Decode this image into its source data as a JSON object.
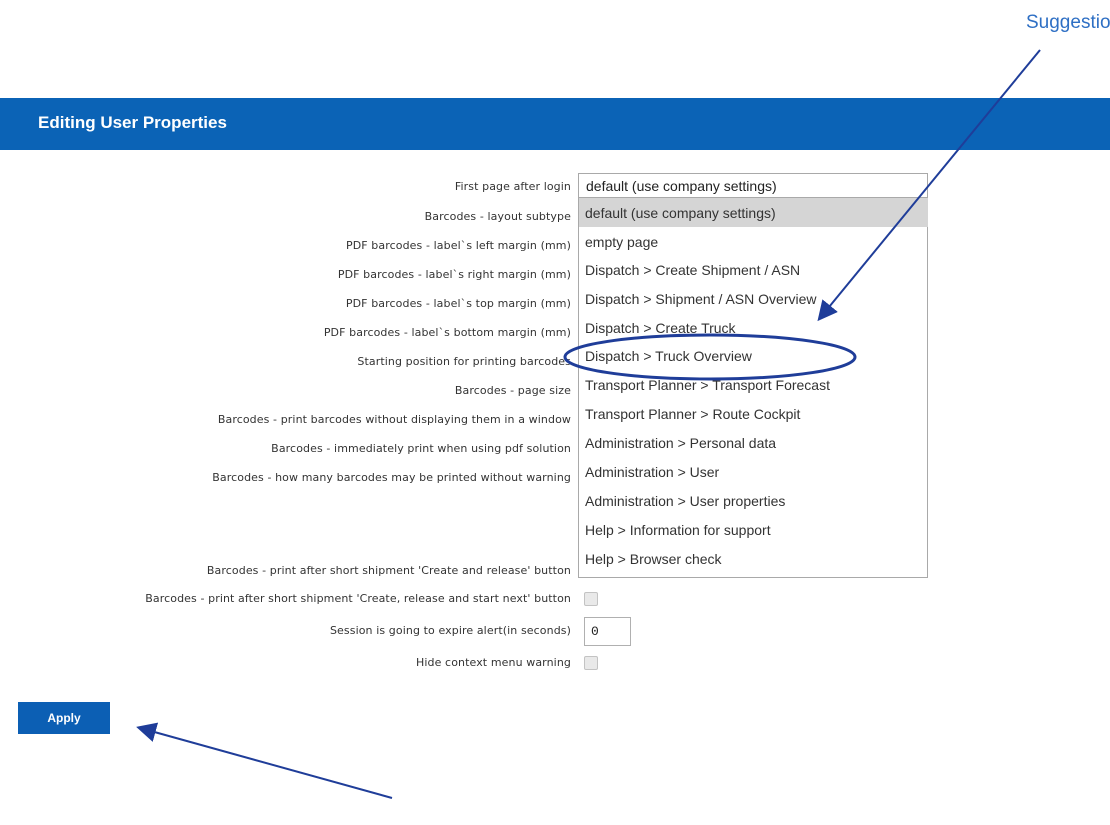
{
  "annotation": {
    "suggestion_label": "Suggestion"
  },
  "header": {
    "title": "Editing User Properties"
  },
  "form": {
    "labels": [
      "First page after login",
      "Barcodes - layout subtype",
      "PDF barcodes - label`s left margin (mm)",
      "PDF barcodes - label`s right margin (mm)",
      "PDF barcodes - label`s top margin (mm)",
      "PDF barcodes - label`s bottom margin (mm)",
      "Starting position for printing barcodes",
      "Barcodes - page size",
      "Barcodes - print barcodes without displaying them in a window",
      "Barcodes - immediately print when using pdf solution",
      "Barcodes - how many barcodes may be printed without warning",
      "Barcodes - print after short shipment 'Create and release' button",
      "Barcodes - print after short shipment 'Create, release and start next' button",
      "Session is going to expire alert(in seconds)",
      "Hide context menu warning"
    ],
    "first_page_select": {
      "selected": "default (use company settings)"
    },
    "dropdown_options": [
      "default (use company settings)",
      "empty page",
      "Dispatch > Create Shipment / ASN",
      "Dispatch > Shipment / ASN Overview",
      "Dispatch > Create Truck",
      "Dispatch > Truck Overview",
      "Transport Planner > Transport Forecast",
      "Transport Planner > Route Cockpit",
      "Administration > Personal data",
      "Administration > User",
      "Administration > User properties",
      "Help > Information for support",
      "Help > Browser check"
    ],
    "session_alert_value": "0"
  },
  "actions": {
    "apply_label": "Apply"
  },
  "colors": {
    "header_bg": "#0b63b6",
    "annotation_blue": "#1f3d99",
    "suggestion_text": "#2e6fc4"
  }
}
